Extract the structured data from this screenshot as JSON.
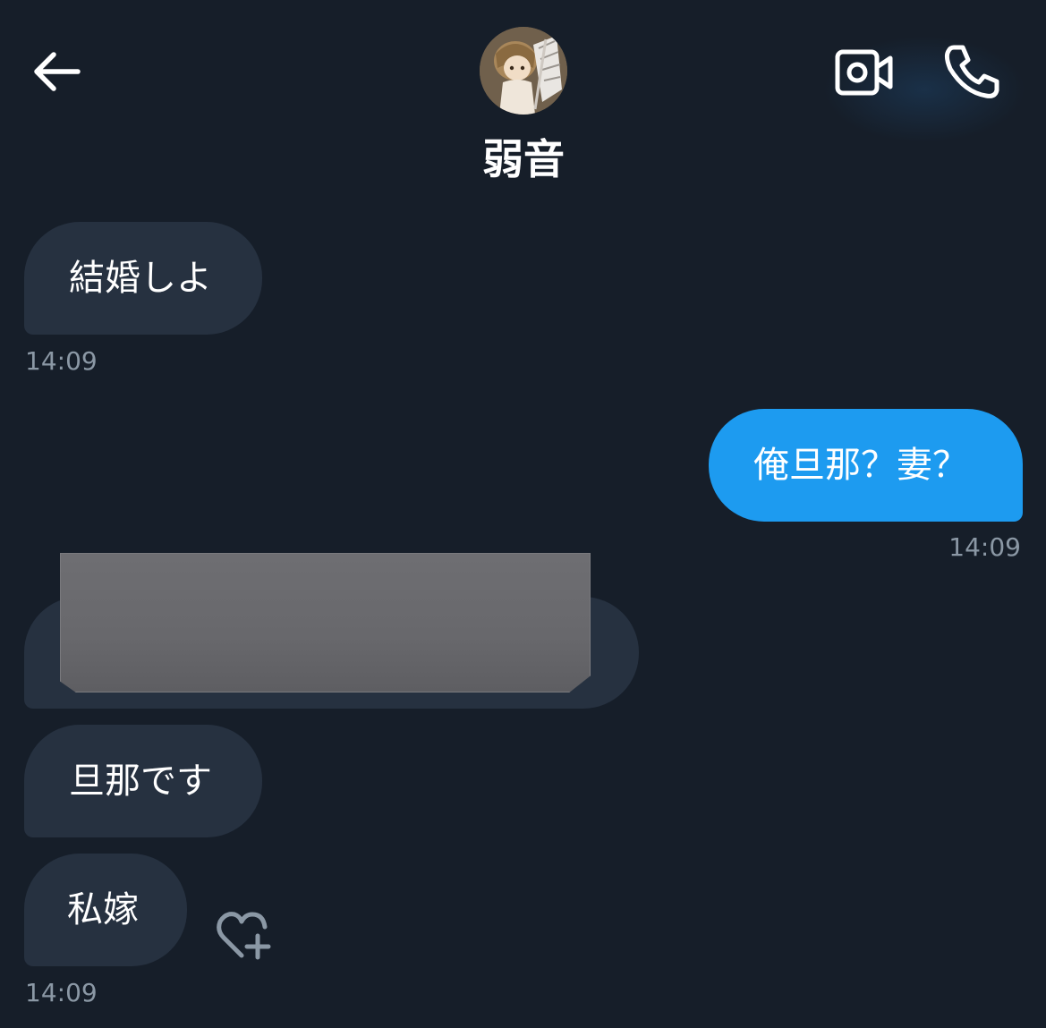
{
  "header": {
    "contact_name": "弱音",
    "back_icon": "arrow-left-icon",
    "video_icon": "video-camera-icon",
    "call_icon": "phone-icon",
    "avatar_icon": "avatar-image"
  },
  "messages": [
    {
      "direction": "incoming",
      "text": "結婚しよ",
      "time": "14:09"
    },
    {
      "direction": "outgoing",
      "text": "俺旦那？妻？",
      "time": "14:09"
    },
    {
      "direction": "incoming",
      "text": "",
      "redacted": true
    },
    {
      "direction": "incoming",
      "text": "旦那です"
    },
    {
      "direction": "incoming",
      "text": "私嫁",
      "time": "14:09"
    }
  ],
  "reaction_icon": "heart-plus-icon",
  "colors": {
    "background": "#161e29",
    "incoming_bubble": "#263140",
    "outgoing_bubble": "#1d9bf0",
    "timestamp": "#8b98a5"
  }
}
